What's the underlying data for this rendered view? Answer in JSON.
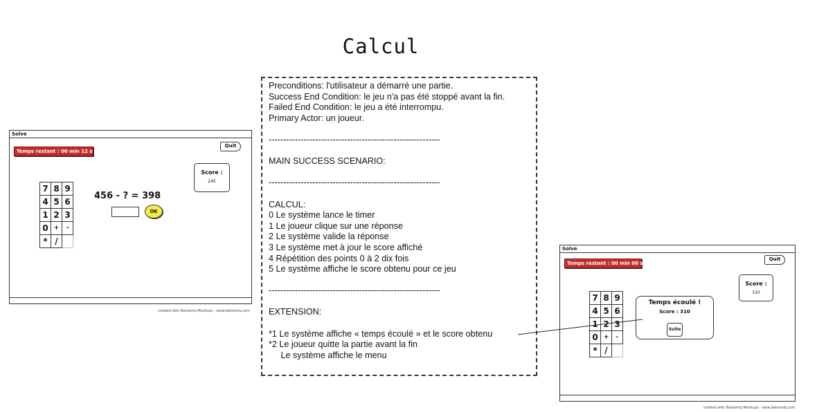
{
  "title": "Calcul",
  "credit": "created with Balsamiq Mockups - www.balsamiq.com",
  "left_window": {
    "title": "Solve",
    "timer": "Temps restant : 00 min 12 s",
    "quit": "Quit",
    "score_label": "Score :",
    "score_value": "245",
    "keypad": [
      [
        "7",
        "8",
        "9"
      ],
      [
        "4",
        "5",
        "6"
      ],
      [
        "1",
        "2",
        "3"
      ],
      [
        "0",
        "+",
        "-"
      ],
      [
        "*",
        "/",
        ""
      ]
    ],
    "equation": "456 -  ? = 398",
    "ok": "OK"
  },
  "right_window": {
    "title": "Solve",
    "timer": "Temps restant : 00 min 00 s",
    "quit": "Quit",
    "score_label": "Score :",
    "score_value": "310",
    "keypad": [
      [
        "7",
        "8",
        "9"
      ],
      [
        "4",
        "5",
        "6"
      ],
      [
        "1",
        "2",
        "3"
      ],
      [
        "0",
        "+",
        "-"
      ],
      [
        "*",
        "/",
        ""
      ]
    ],
    "dialog_title": "Temps écoulé !",
    "dialog_score": "Score : 310",
    "suite": "Suite"
  },
  "spec_lines": [
    "Preconditions: l'utilisateur a démarré une partie.",
    "Success End Condition: le jeu n'a pas été stoppé avant la fin.",
    "Failed End Condition: le jeu a été interrompu.",
    "Primary Actor: un joueur.",
    "",
    "-----------------------------------------------------------",
    "",
    "MAIN SUCCESS SCENARIO:",
    "",
    "-----------------------------------------------------------",
    "",
    "CALCUL:",
    "0 Le système lance le timer",
    "1 Le joueur clique sur une réponse",
    "2 Le système valide la réponse",
    "3 Le système met à jour le score affiché",
    "4 Répétition des points 0 à 2 dix fois",
    "5 Le système affiche le score obtenu pour ce jeu",
    "",
    "-----------------------------------------------------------",
    "",
    "EXTENSION:",
    "",
    "*1 Le système affiche « temps écoulé » et le score obtenu",
    "*2 Le joueur quitte la partie avant la fin",
    "     Le système affiche le menu"
  ]
}
